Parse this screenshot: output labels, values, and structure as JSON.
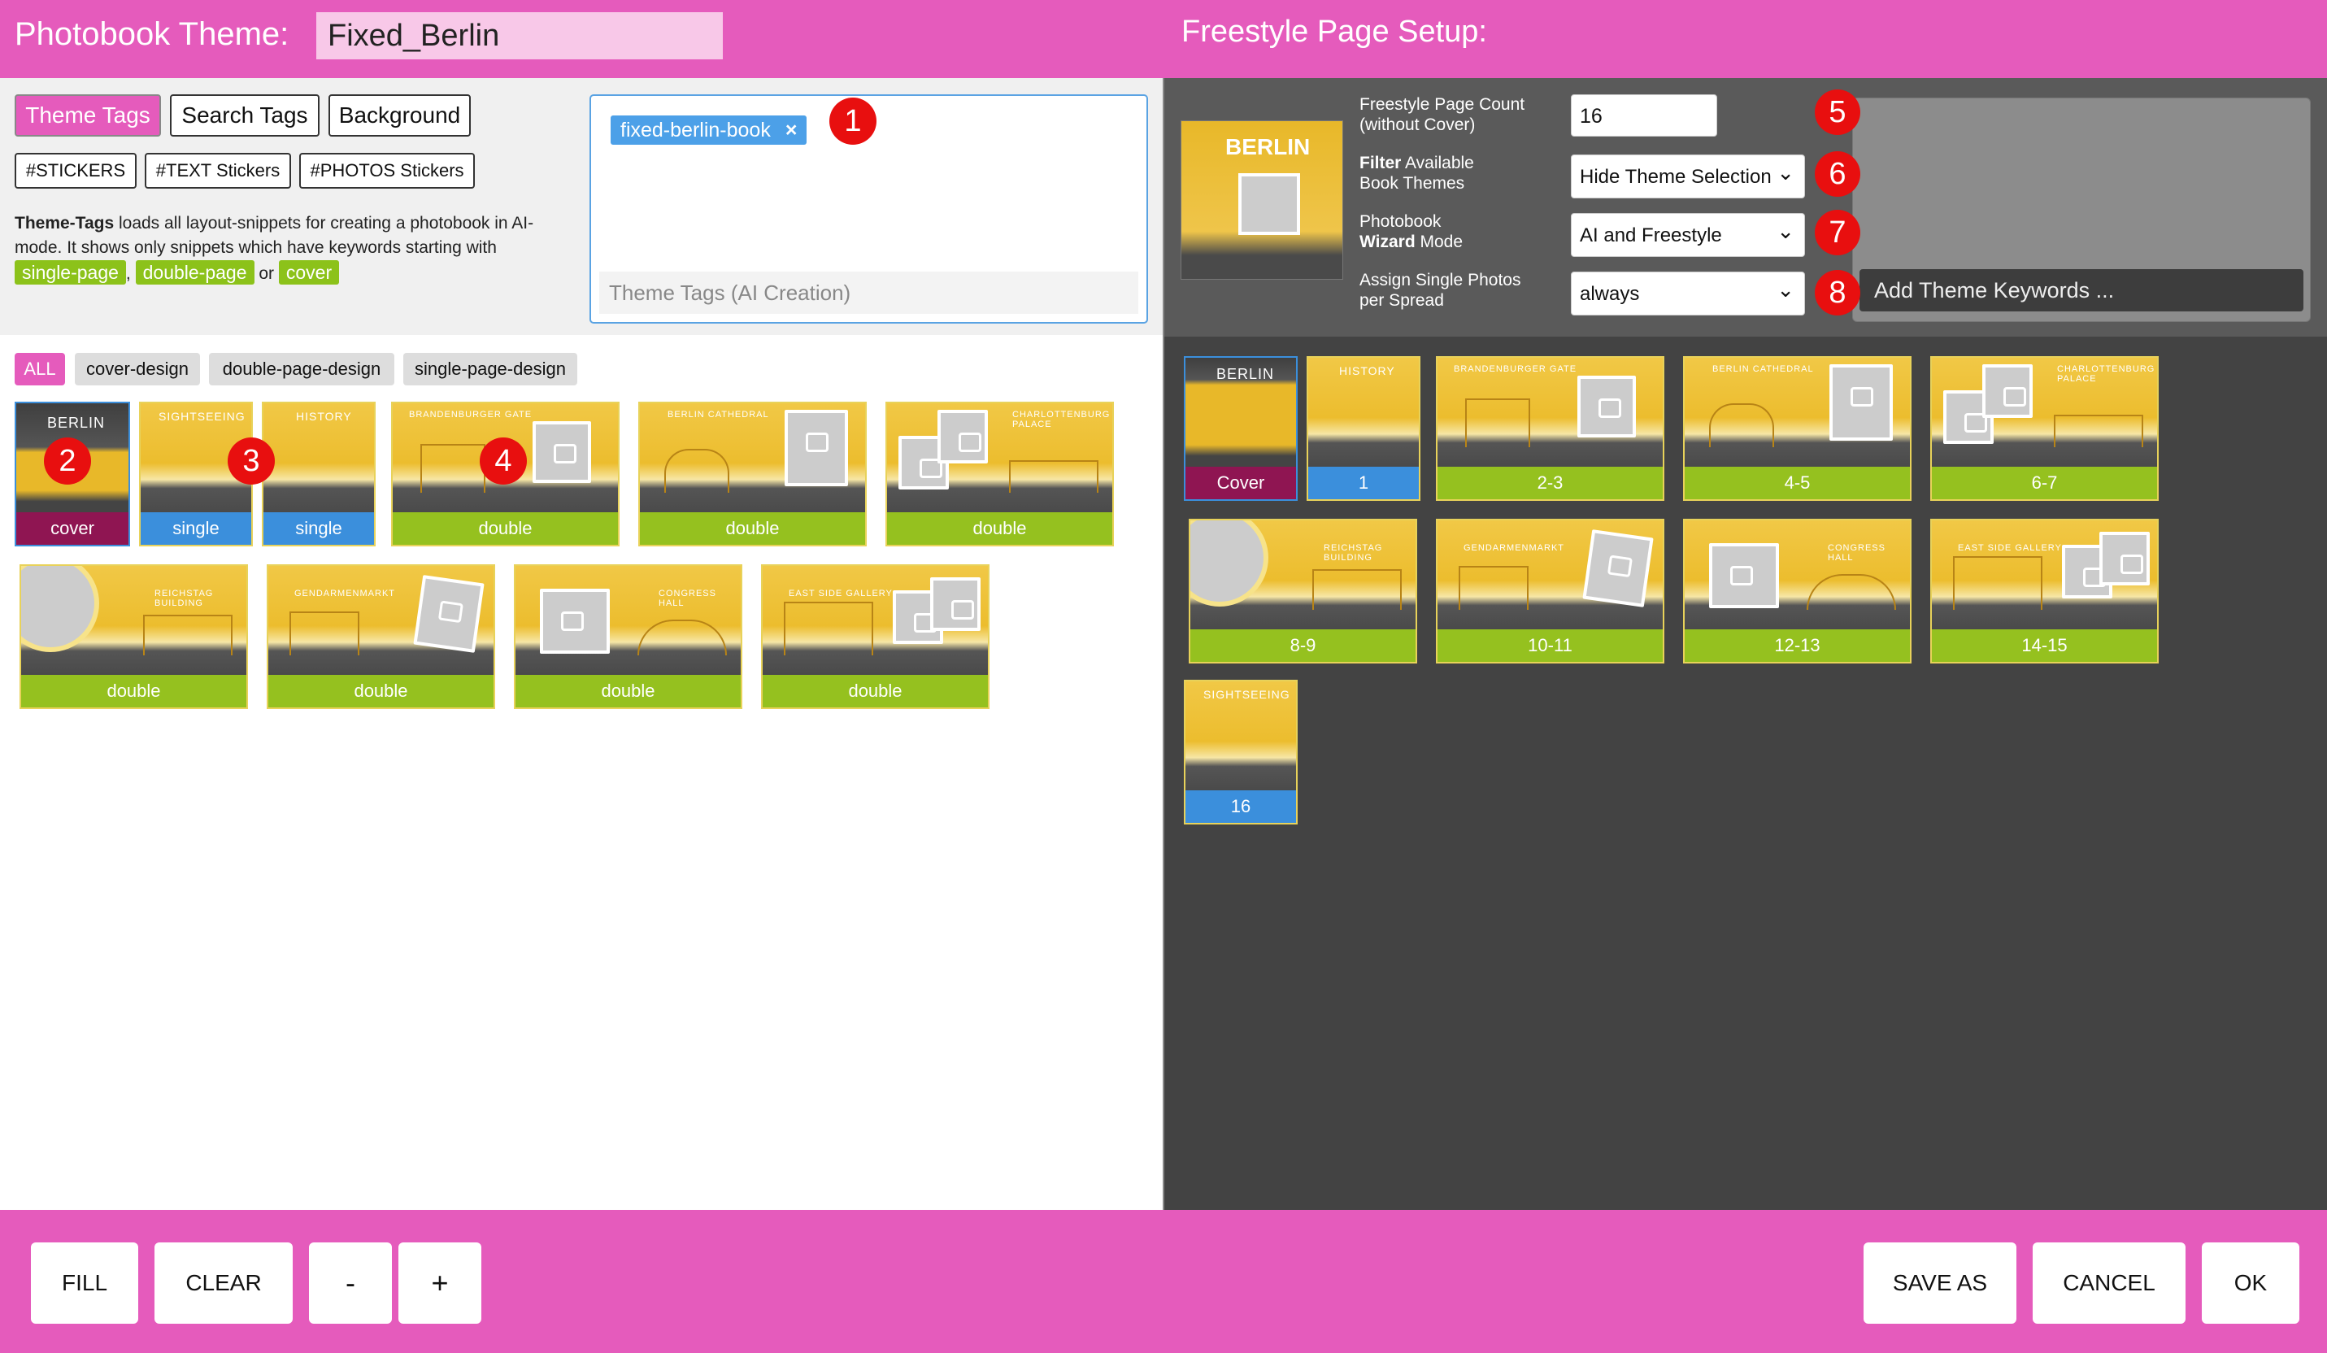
{
  "header": {
    "left_title": "Photobook Theme:",
    "theme_name": "Fixed_Berlin",
    "right_title": "Freestyle Page Setup:"
  },
  "tabs": {
    "theme_tags": "Theme Tags",
    "search_tags": "Search Tags",
    "background": "Background"
  },
  "stickers": {
    "stickers": "#STICKERS",
    "text": "#TEXT Stickers",
    "photos": "#PHOTOS Stickers"
  },
  "description": {
    "bold": "Theme-Tags",
    "line1": " loads all layout-snippets for creating a photobook in AI-mode. It shows only snippets which have keywords starting with",
    "tag1": "single-page",
    "sep1": ",",
    "tag2": "double-page",
    "sep2": "or",
    "tag3": "cover"
  },
  "tag_box": {
    "chip_label": "fixed-berlin-book",
    "chip_remove": "×",
    "placeholder": "Theme Tags (AI Creation)"
  },
  "badges": [
    "1",
    "2",
    "3",
    "4",
    "5",
    "6",
    "7",
    "8"
  ],
  "filters": [
    "ALL",
    "cover-design",
    "double-page-design",
    "single-page-design"
  ],
  "left_thumbs": [
    {
      "caption": "cover",
      "label": "BERLIN"
    },
    {
      "caption": "single",
      "label": "SIGHTSEEING"
    },
    {
      "caption": "single",
      "label": "HISTORY"
    },
    {
      "caption": "double",
      "label": "BRANDENBURGER GATE"
    },
    {
      "caption": "double",
      "label": "BERLIN CATHEDRAL"
    },
    {
      "caption": "double",
      "label": "CHARLOTTENBURG PALACE"
    },
    {
      "caption": "double",
      "label": "REICHSTAG BUILDING"
    },
    {
      "caption": "double",
      "label": "GENDARMENMARKT"
    },
    {
      "caption": "double",
      "label": "CONGRESS HALL"
    },
    {
      "caption": "double",
      "label": "EAST SIDE GALLERY"
    }
  ],
  "freestyle": {
    "page_count_label_1": "Freestyle Page Count",
    "page_count_label_2": "(without Cover)",
    "page_count_value": "16",
    "filter_label_bold": "Filter",
    "filter_label_rest": " Available",
    "filter_label_2": "Book Themes",
    "filter_value": "Hide Theme Selection",
    "wizard_label_1": "Photobook",
    "wizard_label_bold": "Wizard",
    "wizard_label_rest": " Mode",
    "wizard_value": "AI and Freestyle",
    "assign_label_1": "Assign Single Photos",
    "assign_label_2": "per Spread",
    "assign_value": "always",
    "keywords_placeholder": "Add Theme Keywords ...",
    "preview_label": "BERLIN"
  },
  "right_thumbs": [
    {
      "caption": "Cover",
      "label": "BERLIN"
    },
    {
      "caption": "1",
      "label": "HISTORY"
    },
    {
      "caption": "2-3",
      "label": "BRANDENBURGER GATE"
    },
    {
      "caption": "4-5",
      "label": "BERLIN CATHEDRAL"
    },
    {
      "caption": "6-7",
      "label": "CHARLOTTENBURG PALACE"
    },
    {
      "caption": "8-9",
      "label": "REICHSTAG BUILDING"
    },
    {
      "caption": "10-11",
      "label": "GENDARMENMARKT"
    },
    {
      "caption": "12-13",
      "label": "CONGRESS HALL"
    },
    {
      "caption": "14-15",
      "label": "EAST SIDE GALLERY"
    },
    {
      "caption": "16",
      "label": "SIGHTSEEING"
    }
  ],
  "footer": {
    "fill": "FILL",
    "clear": "CLEAR",
    "minus": "-",
    "plus": "+",
    "save_as": "SAVE AS",
    "cancel": "CANCEL",
    "ok": "OK"
  },
  "colors": {
    "accent": "#e55bbc",
    "green": "#95c11f",
    "blue": "#3b8fdc",
    "maroon": "#8f1552",
    "badge": "#e80f0f"
  }
}
